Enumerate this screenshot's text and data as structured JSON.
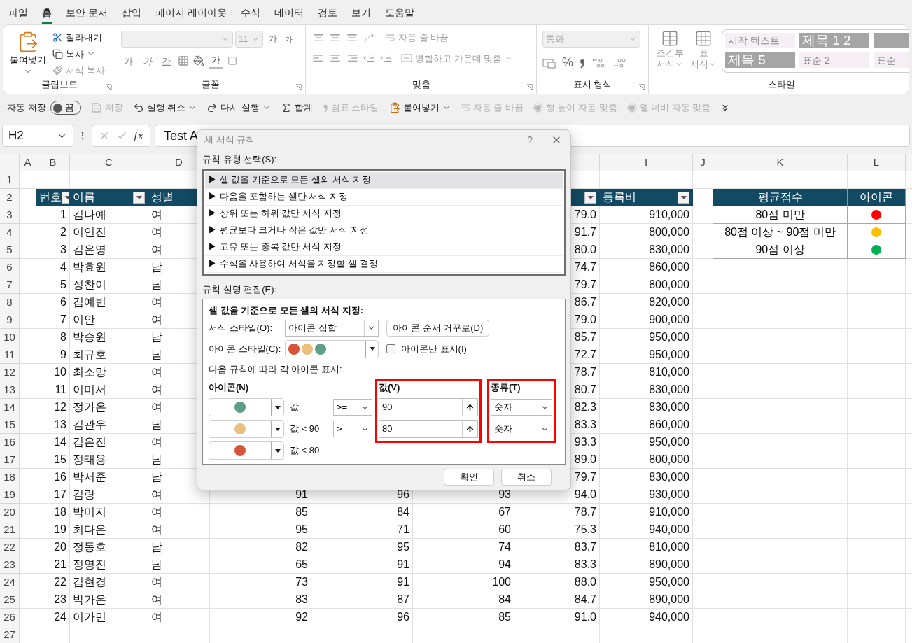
{
  "ribbon_tabs": [
    {
      "label": "파일",
      "selected": false
    },
    {
      "label": "홈",
      "selected": true
    },
    {
      "label": "보안 문서",
      "selected": false
    },
    {
      "label": "삽입",
      "selected": false
    },
    {
      "label": "페이지 레이아웃",
      "selected": false
    },
    {
      "label": "수식",
      "selected": false
    },
    {
      "label": "데이터",
      "selected": false
    },
    {
      "label": "검토",
      "selected": false
    },
    {
      "label": "보기",
      "selected": false
    },
    {
      "label": "도움말",
      "selected": false
    }
  ],
  "ribbon": {
    "clipboard": {
      "title": "클립보드",
      "paste": "붙여넣기",
      "cut": "잘라내기",
      "copy": "복사",
      "format_painter": {
        "label": "서식 복사",
        "disabled": true
      }
    },
    "font": {
      "title": "글꼴",
      "size": "11",
      "grow": "가",
      "shrink": "가",
      "bold": "가",
      "italic": "가",
      "underline": "간",
      "font_color": "가"
    },
    "alignment": {
      "title": "맞춤",
      "wrap": {
        "label": "자동 줄 바꿈",
        "disabled": true
      },
      "merge": {
        "label": "병합하고 가운데 맞춤",
        "disabled": true
      }
    },
    "number": {
      "title": "표시 형식",
      "format": "통화",
      "percent": "%"
    },
    "styles": {
      "title": "스타일",
      "conditional": [
        "조건부",
        "서식"
      ],
      "table": [
        "표",
        "서식"
      ],
      "gallery": [
        {
          "label": "시작 텍스트",
          "kind": "plain"
        },
        {
          "label": "제목 1 2",
          "kind": "heading"
        },
        {
          "kind": "heading"
        },
        {
          "label": "제목 5",
          "kind": "heading"
        },
        {
          "label": "표준 2",
          "kind": "plain"
        },
        {
          "label": "표준",
          "kind": "plain"
        }
      ]
    }
  },
  "quick_access": [
    {
      "kind": "label",
      "label": "자동 저장"
    },
    {
      "kind": "toggle",
      "label": "끔",
      "on": false
    },
    {
      "kind": "save",
      "label": "저장",
      "disabled": true,
      "menu": false
    },
    {
      "kind": "undo",
      "label": "실행 취소",
      "disabled": false,
      "menu": true
    },
    {
      "kind": "redo",
      "label": "다시 실행",
      "disabled": false,
      "menu": true
    },
    {
      "kind": "sum",
      "label": "합계",
      "disabled": false,
      "menu": false
    },
    {
      "kind": "comma",
      "label": "쉼표 스타일",
      "disabled": true,
      "menu": false
    },
    {
      "kind": "paste",
      "label": "붙여넣기",
      "disabled": false,
      "menu": true
    },
    {
      "kind": "wrap",
      "label": "자동 줄 바꿈",
      "disabled": true,
      "menu": false
    },
    {
      "kind": "autofit",
      "label": "행 높이 자동 맞춤",
      "disabled": true,
      "menu": false
    },
    {
      "kind": "autofit",
      "label": "열 너비 자동 맞춤",
      "disabled": true,
      "menu": false
    },
    {
      "kind": "overflow"
    }
  ],
  "formula_bar": {
    "name_box": "H2",
    "fx": "fx",
    "formula": "Test A"
  },
  "sheet": {
    "column_letters": {
      "a": "A",
      "b": "B",
      "c": "C",
      "d": "D",
      "i": "I",
      "j": "J",
      "k": "K",
      "l": "L"
    },
    "rows": [
      {
        "n": "1",
        "kind": "blank"
      },
      {
        "n": "2",
        "kind": "header",
        "b": {
          "text": "번호",
          "filter": true
        },
        "c": {
          "text": "이름",
          "filter": true
        },
        "d": {
          "text": "성별"
        },
        "h": {
          "filter": true
        },
        "i": {
          "text": "등록비",
          "filter": true
        },
        "k": {
          "text": "평균점수"
        },
        "l": {
          "text": "아이콘"
        }
      },
      {
        "n": "3",
        "kind": "data",
        "b": "1",
        "c": "김나예",
        "d": "여",
        "h": "79.0",
        "i": "910,000",
        "k": "80점 미만",
        "l": {
          "color": "#ff0000"
        }
      },
      {
        "n": "4",
        "kind": "data",
        "b": "2",
        "c": "이연진",
        "d": "여",
        "h": "91.7",
        "i": "800,000",
        "k": "80점 이상 ~ 90점 미만",
        "l": {
          "color": "#ffc000"
        }
      },
      {
        "n": "5",
        "kind": "data",
        "b": "3",
        "c": "김은영",
        "d": "여",
        "h": "80.0",
        "i": "830,000",
        "k": "90점 이상",
        "l": {
          "color": "#00b050"
        }
      },
      {
        "n": "6",
        "kind": "data",
        "b": "4",
        "c": "박효원",
        "d": "남",
        "h": "74.7",
        "i": "860,000"
      },
      {
        "n": "7",
        "kind": "data",
        "b": "5",
        "c": "정찬이",
        "d": "남",
        "h": "79.7",
        "i": "800,000"
      },
      {
        "n": "8",
        "kind": "data",
        "b": "6",
        "c": "김예빈",
        "d": "여",
        "h": "86.7",
        "i": "820,000"
      },
      {
        "n": "9",
        "kind": "data",
        "b": "7",
        "c": "이안",
        "d": "여",
        "h": "79.0",
        "i": "900,000"
      },
      {
        "n": "10",
        "kind": "data",
        "b": "8",
        "c": "박승원",
        "d": "남",
        "h": "85.7",
        "i": "950,000"
      },
      {
        "n": "11",
        "kind": "data",
        "b": "9",
        "c": "최규호",
        "d": "남",
        "h": "72.7",
        "i": "950,000"
      },
      {
        "n": "12",
        "kind": "data",
        "b": "10",
        "c": "최소망",
        "d": "여",
        "h": "78.7",
        "i": "810,000"
      },
      {
        "n": "13",
        "kind": "data",
        "b": "11",
        "c": "이미서",
        "d": "여",
        "h": "80.7",
        "i": "830,000"
      },
      {
        "n": "14",
        "kind": "data",
        "b": "12",
        "c": "정가온",
        "d": "여",
        "h": "82.3",
        "i": "830,000"
      },
      {
        "n": "15",
        "kind": "data",
        "b": "13",
        "c": "김관우",
        "d": "남",
        "h": "83.3",
        "i": "860,000"
      },
      {
        "n": "16",
        "kind": "data",
        "b": "14",
        "c": "김은진",
        "d": "여",
        "h": "93.3",
        "i": "950,000"
      },
      {
        "n": "17",
        "kind": "data",
        "b": "15",
        "c": "정태용",
        "d": "남",
        "h": "89.0",
        "i": "800,000"
      },
      {
        "n": "18",
        "kind": "data",
        "b": "16",
        "c": "박서준",
        "d": "남",
        "h": "79.7",
        "i": "830,000"
      },
      {
        "n": "19",
        "kind": "data",
        "b": "17",
        "c": "김랑",
        "d": "여",
        "e": "91",
        "f": "96",
        "g": "93",
        "h": "94.0",
        "i": "930,000"
      },
      {
        "n": "20",
        "kind": "data",
        "b": "18",
        "c": "박미지",
        "d": "여",
        "e": "85",
        "f": "84",
        "g": "67",
        "h": "78.7",
        "i": "910,000"
      },
      {
        "n": "21",
        "kind": "data",
        "b": "19",
        "c": "최다은",
        "d": "여",
        "e": "95",
        "f": "71",
        "g": "60",
        "h": "75.3",
        "i": "940,000"
      },
      {
        "n": "22",
        "kind": "data",
        "b": "20",
        "c": "정동호",
        "d": "남",
        "e": "82",
        "f": "95",
        "g": "74",
        "h": "83.7",
        "i": "810,000"
      },
      {
        "n": "23",
        "kind": "data",
        "b": "21",
        "c": "정영진",
        "d": "남",
        "e": "65",
        "f": "91",
        "g": "94",
        "h": "83.3",
        "i": "890,000"
      },
      {
        "n": "24",
        "kind": "data",
        "b": "22",
        "c": "김현경",
        "d": "여",
        "e": "73",
        "f": "91",
        "g": "100",
        "h": "88.0",
        "i": "950,000"
      },
      {
        "n": "25",
        "kind": "data",
        "b": "23",
        "c": "박가은",
        "d": "여",
        "e": "83",
        "f": "87",
        "g": "84",
        "h": "84.7",
        "i": "890,000"
      },
      {
        "n": "26",
        "kind": "data",
        "b": "24",
        "c": "이가민",
        "d": "여",
        "e": "92",
        "f": "96",
        "g": "85",
        "h": "91.0",
        "i": "940,000"
      },
      {
        "n": "27",
        "kind": "blank"
      }
    ]
  },
  "dialog": {
    "title": "새 서식 규칙",
    "help": "?",
    "rule_type_label": "규칙 유형 선택(S):",
    "rule_types": [
      {
        "label": "▶ 셀 값을 기준으로 모든 셀의 서식 지정",
        "selected": true
      },
      {
        "label": "▶ 다음을 포함하는 셀만 서식 지정",
        "selected": false
      },
      {
        "label": "▶ 상위 또는 하위 값만 서식 지정",
        "selected": false
      },
      {
        "label": "▶ 평균보다 크거나 작은 값만 서식 지정",
        "selected": false
      },
      {
        "label": "▶ 고유 또는 중복 값만 서식 지정",
        "selected": false
      },
      {
        "label": "▶ 수식을 사용하여 서식을 지정할 셀 결정",
        "selected": false
      }
    ],
    "edit_label": "규칙 설명 편집(E):",
    "edit_title": "셀 값을 기준으로 모든 셀의 서식 지정:",
    "format_style": {
      "label": "서식 스타일(O):",
      "value": "아이콘 집합"
    },
    "reverse_button": "아이콘 순서 거꾸로(D)",
    "icon_style": {
      "label": "아이콘 스타일(C):",
      "icons": [
        {
          "color": "#d4553a"
        },
        {
          "color": "#e9c07e"
        },
        {
          "color": "#5e9e86"
        }
      ]
    },
    "icon_only": {
      "label": "아이콘만 표시(I)",
      "checked": false
    },
    "rules": {
      "caption": "다음 규칙에 따라 각 아이콘 표시:",
      "icon_header": "아이콘(N)",
      "value_header": {
        "label": "값(V)",
        "highlighted": true
      },
      "type_header": {
        "label": "종류(T)",
        "highlighted": true
      },
      "rows": [
        {
          "color": "#5e9e86",
          "condition": "값",
          "operator": ">=",
          "value": "90",
          "type": "숫자"
        },
        {
          "color": "#e9c07e",
          "condition": "값 < 90",
          "operator": ">=",
          "value": "80",
          "type": "숫자"
        },
        {
          "color": "#d4553a",
          "condition": "값 < 80"
        }
      ]
    },
    "buttons": [
      "확인",
      "취소"
    ]
  }
}
